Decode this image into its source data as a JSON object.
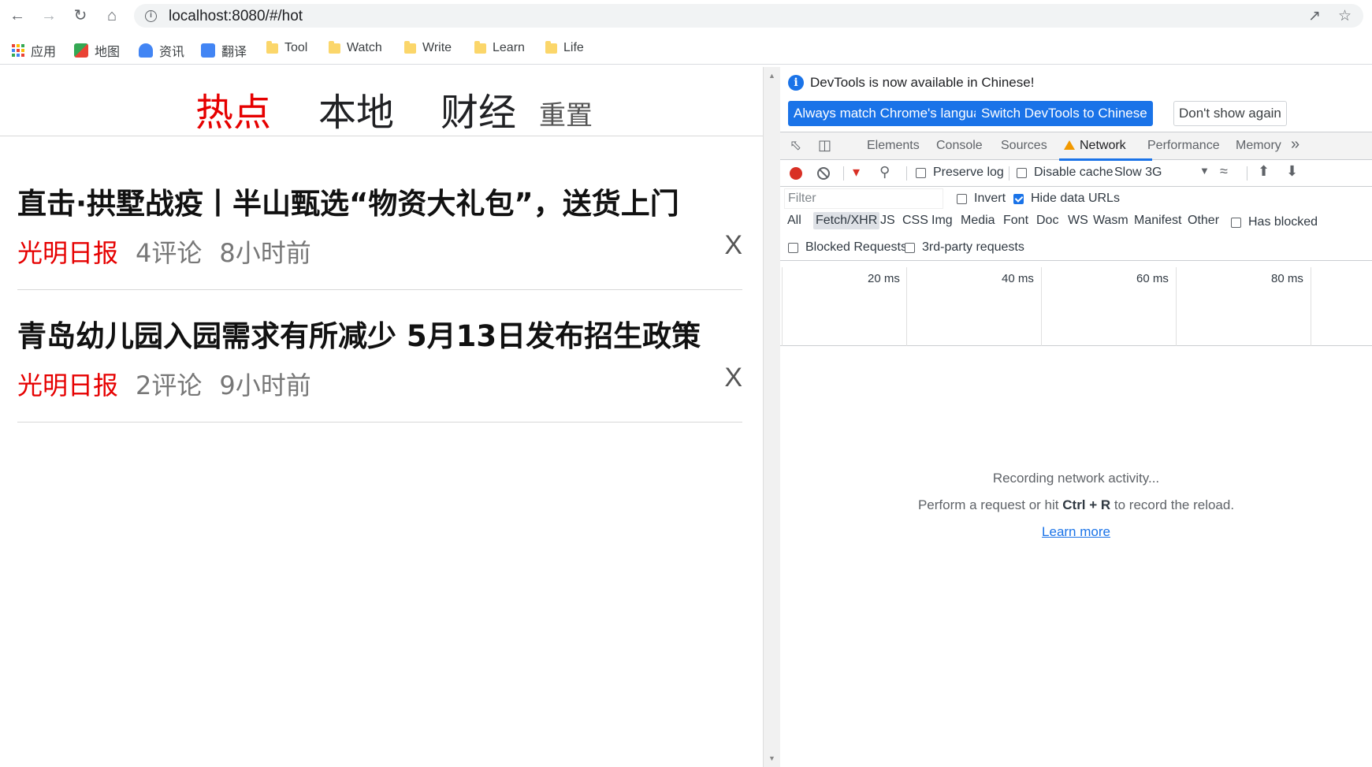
{
  "browser": {
    "url": "localhost:8080/#/hot",
    "bookmarks": [
      {
        "label": "应用",
        "icon": "apps-grid-icon"
      },
      {
        "label": "地图",
        "icon": "maps-icon"
      },
      {
        "label": "资讯",
        "icon": "news-icon"
      },
      {
        "label": "翻译",
        "icon": "translate-icon"
      },
      {
        "label": "Tool",
        "icon": "folder-icon"
      },
      {
        "label": "Watch",
        "icon": "folder-icon"
      },
      {
        "label": "Write",
        "icon": "folder-icon"
      },
      {
        "label": "Learn",
        "icon": "folder-icon"
      },
      {
        "label": "Life",
        "icon": "folder-icon"
      }
    ]
  },
  "page": {
    "tabs": [
      "热点",
      "本地",
      "财经"
    ],
    "active_tab": "热点",
    "reset_label": "重置",
    "news": [
      {
        "title": "直击·拱墅战疫丨半山甄选“物资大礼包”，送货上门",
        "source": "光明日报",
        "comments": "4评论",
        "time": "8小时前",
        "close": "X"
      },
      {
        "title": "青岛幼儿园入园需求有所减少 5月13日发布招生政策",
        "source": "光明日报",
        "comments": "2评论",
        "time": "9小时前",
        "close": "X"
      }
    ],
    "accent_color": "#e60000"
  },
  "devtools": {
    "notice": "DevTools is now available in Chinese!",
    "btn_match": "Always match Chrome's language",
    "btn_switch": "Switch DevTools to Chinese",
    "btn_dont_show": "Don't show again",
    "tabs": [
      "Elements",
      "Console",
      "Sources",
      "Network",
      "Performance",
      "Memory"
    ],
    "active_tab": "Network",
    "more_tabs": "»",
    "preserve_log": "Preserve log",
    "disable_cache": "Disable cache",
    "throttle": "Slow 3G",
    "filter_placeholder": "Filter",
    "invert": "Invert",
    "hide_data_urls": "Hide data URLs",
    "types": [
      "All",
      "Fetch/XHR",
      "JS",
      "CSS",
      "Img",
      "Media",
      "Font",
      "Doc",
      "WS",
      "Wasm",
      "Manifest",
      "Other"
    ],
    "selected_type": "Fetch/XHR",
    "has_blocked": "Has blocked",
    "blocked_requests": "Blocked Requests",
    "third_party": "3rd-party requests",
    "ticks": [
      "20 ms",
      "40 ms",
      "60 ms",
      "80 ms"
    ],
    "empty_l1": "Recording network activity...",
    "empty_l2_pre": "Perform a request or hit ",
    "empty_l2_key": "Ctrl + R",
    "empty_l2_post": " to record the reload.",
    "learn_more": "Learn more"
  }
}
